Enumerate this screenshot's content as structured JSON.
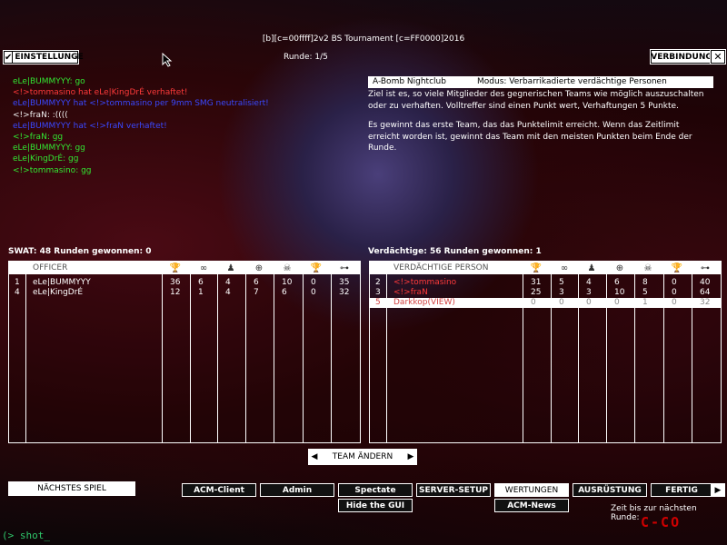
{
  "header": {
    "title": "[b][c=00ffff]2v2 BS Tournament [c=FF0000]2016",
    "round": "Runde: 1/5",
    "settings_label": "EINSTELLUNGE",
    "connection_label": "VERBINDUNG",
    "close_glyph": "✕"
  },
  "chat": [
    {
      "parts": [
        {
          "t": "eLe|BUMMYYY",
          "c": "g"
        },
        {
          "t": ": go",
          "c": "g"
        }
      ]
    },
    {
      "parts": [
        {
          "t": "<!>tommasino",
          "c": "r"
        },
        {
          "t": " hat ",
          "c": "r"
        },
        {
          "t": "eLe|KingDrÉ",
          "c": "r"
        },
        {
          "t": " verhaftet!",
          "c": "r"
        }
      ]
    },
    {
      "parts": [
        {
          "t": "eLe|BUMMYYY",
          "c": "b"
        },
        {
          "t": " hat ",
          "c": "b"
        },
        {
          "t": "<!>tommasino",
          "c": "b"
        },
        {
          "t": " per 9mm SMG neutralisiert!",
          "c": "b"
        }
      ]
    },
    {
      "parts": [
        {
          "t": "<!>fraN",
          "c": "w"
        },
        {
          "t": ":  :((((",
          "c": "w"
        }
      ]
    },
    {
      "parts": [
        {
          "t": "eLe|BUMMYYY",
          "c": "b"
        },
        {
          "t": " hat ",
          "c": "b"
        },
        {
          "t": "<!>fraN",
          "c": "b"
        },
        {
          "t": " verhaftet!",
          "c": "b"
        }
      ]
    },
    {
      "parts": [
        {
          "t": "<!>fraN",
          "c": "g"
        },
        {
          "t": ":  gg",
          "c": "g"
        }
      ]
    },
    {
      "parts": [
        {
          "t": "eLe|BUMMYYY",
          "c": "g"
        },
        {
          "t": ": gg",
          "c": "g"
        }
      ]
    },
    {
      "parts": [
        {
          "t": "eLe|KingDrÉ",
          "c": "g"
        },
        {
          "t": ":  gg",
          "c": "g"
        }
      ]
    },
    {
      "parts": [
        {
          "t": "<!>tommasino",
          "c": "g"
        },
        {
          "t": ":  gg",
          "c": "g"
        }
      ]
    }
  ],
  "map": {
    "name": "A-Bomb Nightclub",
    "mode": "Modus: Verbarrikadierte verdächtige Personen",
    "desc1": "Ziel ist es, so viele Mitglieder des gegnerischen Teams wie möglich auszuschalten oder zu verhaften. Volltreffer sind einen Punkt wert, Verhaftungen 5 Punkte.",
    "desc2": "Es gewinnt das erste Team, das das Punktelimit erreicht. Wenn das Zeitlimit erreicht worden ist, gewinnt das Team mit den meisten Punkten beim Ende der Runde."
  },
  "swat": {
    "header": "SWAT: 48   Runden gewonnen: 0",
    "column_label": "OFFICER",
    "players": [
      {
        "num": "1",
        "name": "eLe|BUMMYYY",
        "stats": [
          "36",
          "6",
          "4",
          "6",
          "10",
          "0",
          "35"
        ]
      },
      {
        "num": "4",
        "name": "eLe|KingDrÉ",
        "stats": [
          "12",
          "1",
          "4",
          "7",
          "6",
          "0",
          "32"
        ]
      }
    ]
  },
  "suspects": {
    "header": "Verdächtige: 56   Runden gewonnen: 1",
    "column_label": "VERDÄCHTIGE PERSON",
    "players": [
      {
        "num": "2",
        "name": "<!>tommasino",
        "stats": [
          "31",
          "5",
          "4",
          "6",
          "8",
          "0",
          "40"
        ],
        "hi": false
      },
      {
        "num": "3",
        "name": "<!>fraN",
        "stats": [
          "25",
          "3",
          "3",
          "10",
          "5",
          "0",
          "64"
        ],
        "hi": false
      },
      {
        "num": "5",
        "name": "Darkkop(VIEW)",
        "stats": [
          "0",
          "0",
          "0",
          "0",
          "1",
          "0",
          "32"
        ],
        "hi": true
      }
    ]
  },
  "stat_icons": [
    "trophy-icon",
    "handcuffs-icon",
    "arrest-icon",
    "crosshair-icon",
    "skull-icon",
    "trophy-small-icon",
    "ping-icon"
  ],
  "stat_glyphs": [
    "🏆",
    "∞",
    "♟",
    "⊕",
    "☠",
    "🏆",
    "⊶"
  ],
  "footer": {
    "change_team": "TEAM ÄNDERN",
    "next_game": "NÄCHSTES SPIEL",
    "acm_client": "ACM-Client",
    "admin": "Admin",
    "spectate": "Spectate",
    "server_setup": "SERVER-SETUP",
    "wertungen": "WERTUNGEN",
    "ausruestung": "AUSRÜSTUNG",
    "fertig": "FERTIG",
    "hide_gui": "Hide the GUI",
    "acm_news": "ACM-News",
    "timer": "Zeit bis zur nächsten Runde:",
    "logo": "C-CO"
  },
  "console": "(> shot_"
}
